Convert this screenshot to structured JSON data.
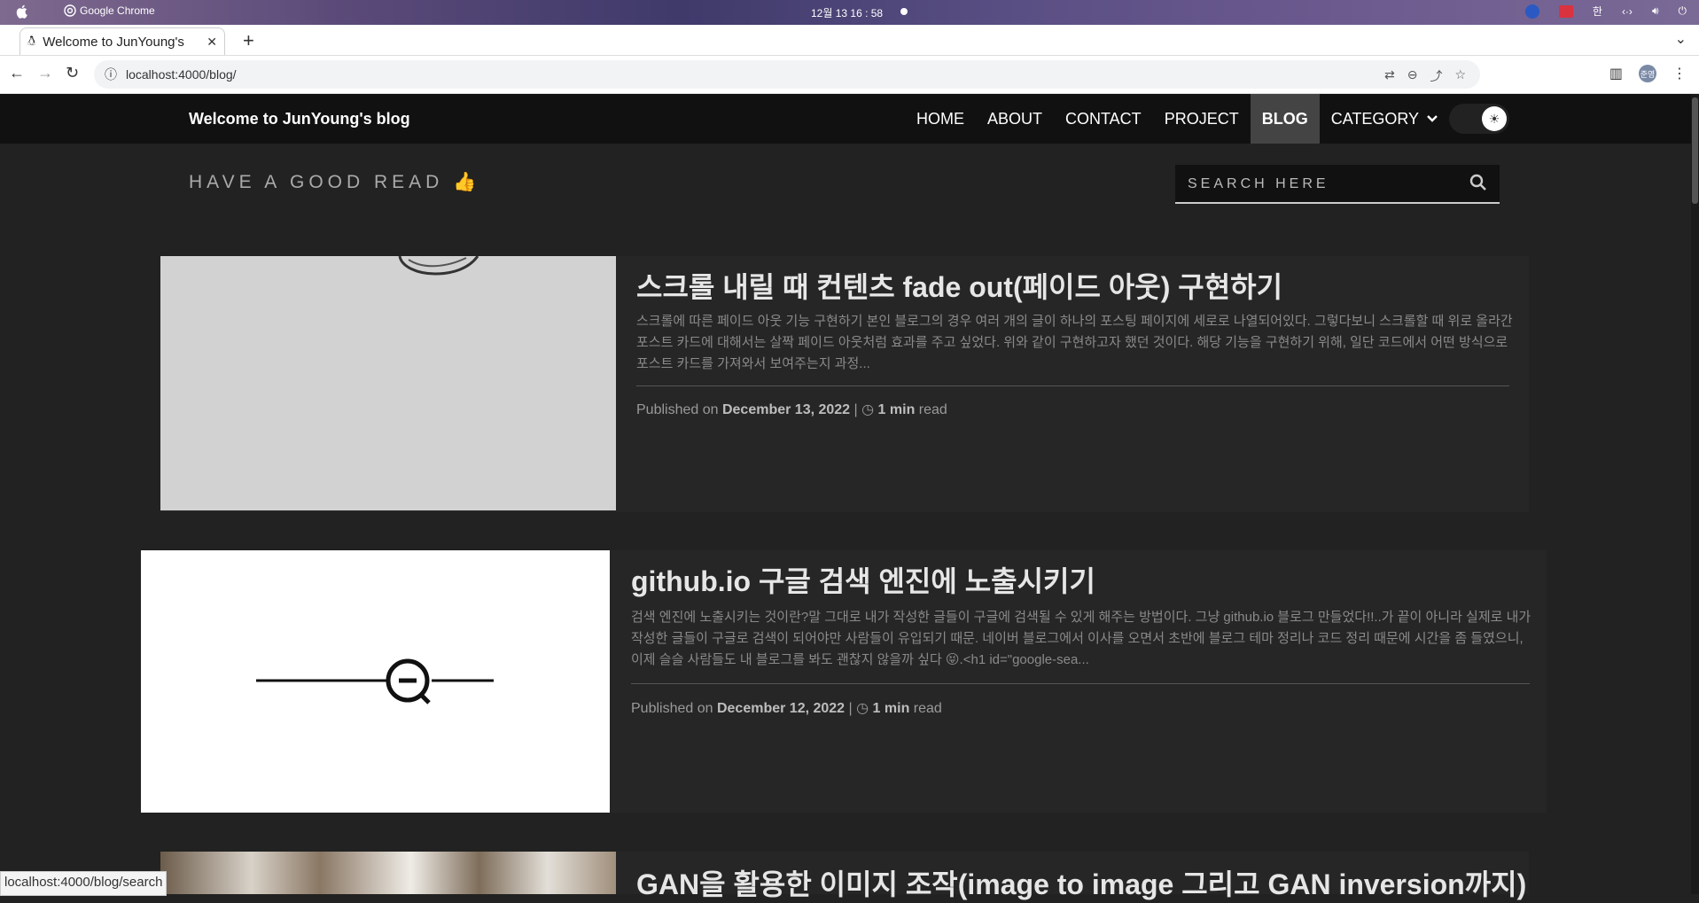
{
  "os": {
    "app_name": "Google Chrome",
    "clock": "12월 13 16 : 58",
    "tray_lang": "한"
  },
  "browser": {
    "tab_title": "Welcome to JunYoung's",
    "url": "localhost:4000/blog/",
    "profile": "준영",
    "status_url": "localhost:4000/blog/search"
  },
  "site": {
    "brand": "Welcome to JunYoung's blog",
    "nav": [
      "HOME",
      "ABOUT",
      "CONTACT",
      "PROJECT",
      "BLOG",
      "CATEGORY"
    ],
    "active_nav": "BLOG",
    "tagline": "HAVE A GOOD READ 👍",
    "search_placeholder": "SEARCH HERE"
  },
  "posts": [
    {
      "title": "스크롤 내릴 때 컨텐츠 fade out(페이드 아웃) 구현하기",
      "excerpt": "스크롤에 따른 페이드 아웃 기능 구현하기 본인 블로그의 경우 여러 개의 글이 하나의 포스팅 페이지에 세로로 나열되어있다. 그렇다보니 스크롤할 때 위로 올라간 포스트 카드에 대해서는 살짝 페이드 아웃처럼 효과를 주고 싶었다. 위와 같이 구현하고자 했던 것이다. 해당 기능을 구현하기 위해, 일단 코드에서 어떤 방식으로 포스트 카드를 가져와서 보여주는지 과정...",
      "published_prefix": "Published on",
      "date": "December 13, 2022",
      "read_time": "1 min",
      "read_suffix": "read"
    },
    {
      "title": "github.io 구글 검색 엔진에 노출시키기",
      "excerpt": "검색 엔진에 노출시키는 것이란?말 그대로 내가 작성한 글들이 구글에 검색될 수 있게 해주는 방법이다. 그냥 github.io 블로그 만들었다!!..가 끝이 아니라 실제로 내가 작성한 글들이 구글로 검색이 되어야만 사람들이 유입되기 때문. 네이버 블로그에서 이사를 오면서 초반에 블로그 테마 정리나 코드 정리 때문에 시간을 좀 들였으니, 이제 슬슬 사람들도 내 블로그를 봐도 괜찮지 않을까 싶다 😝.<h1 id=\"google-sea...",
      "published_prefix": "Published on",
      "date": "December 12, 2022",
      "read_time": "1 min",
      "read_suffix": "read"
    },
    {
      "title": "GAN을 활용한 이미지 조작(image to image 그리고 GAN inversion까지)"
    }
  ]
}
